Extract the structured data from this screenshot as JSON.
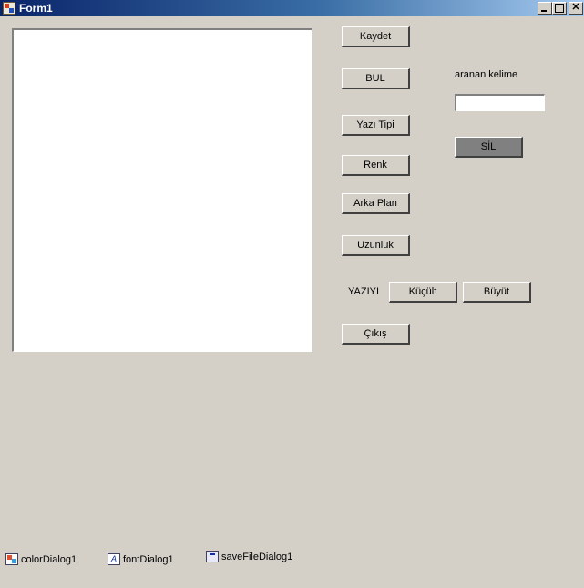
{
  "window": {
    "title": "Form1"
  },
  "buttons": {
    "kaydet": "Kaydet",
    "bul": "BUL",
    "yazi_tipi": "Yazı Tipi",
    "renk": "Renk",
    "arka_plan": "Arka Plan",
    "uzunluk": "Uzunluk",
    "kucult": "Küçült",
    "buyut": "Büyüt",
    "cikis": "Çıkış",
    "sil": "SİL"
  },
  "labels": {
    "aranan_kelime": "aranan kelime",
    "yaziyi": "YAZIYI"
  },
  "editor": {
    "value": ""
  },
  "search": {
    "value": ""
  },
  "components": {
    "color_dialog": "colorDialog1",
    "font_dialog": "fontDialog1",
    "save_file_dialog": "saveFileDialog1"
  },
  "icons": {
    "app": "form-app-icon",
    "minimize": "minimize-icon",
    "maximize": "maximize-icon",
    "close": "close-icon",
    "color_dialog": "color-dialog-icon",
    "font_dialog": "font-dialog-icon",
    "save_file_dialog": "save-file-dialog-icon"
  }
}
